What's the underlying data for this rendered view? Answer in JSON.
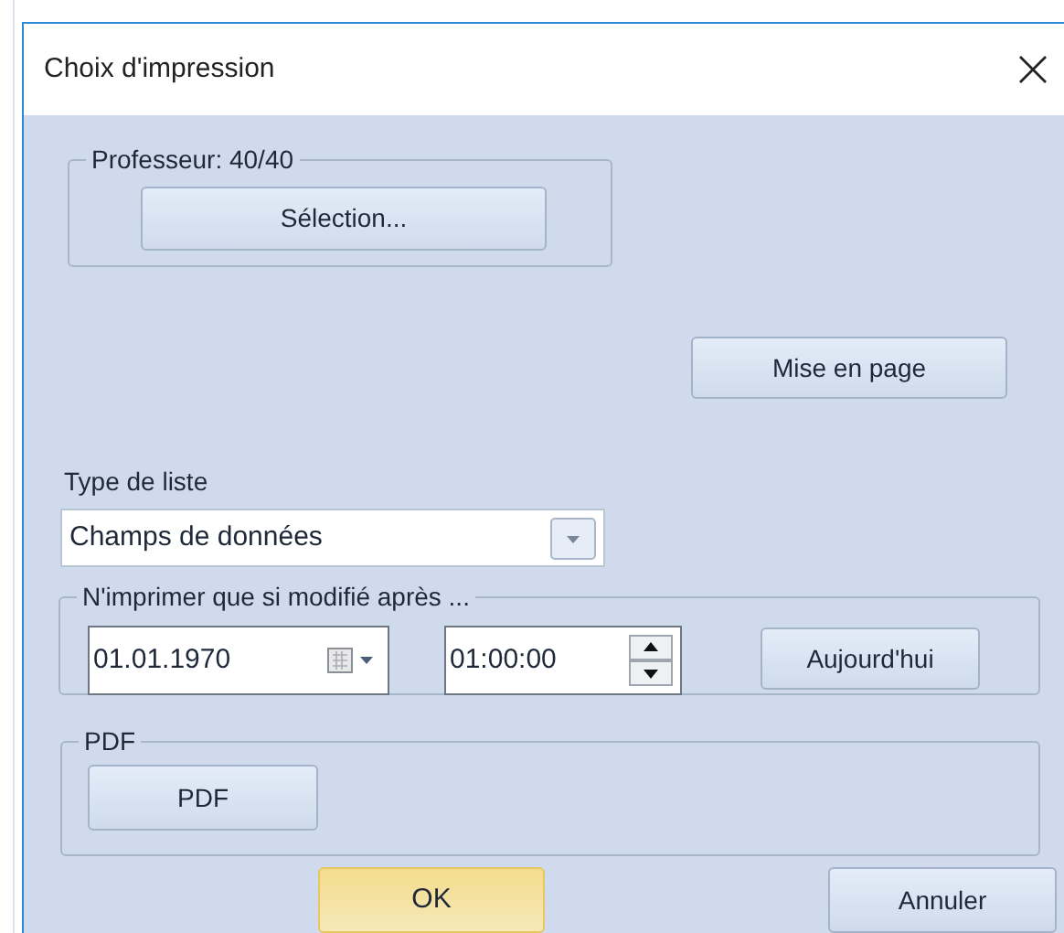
{
  "window": {
    "title": "Choix d'impression"
  },
  "teacher_group": {
    "legend": "Professeur: 40/40",
    "button": "Sélection..."
  },
  "page_setup_button": "Mise en page",
  "list_type": {
    "label": "Type de liste",
    "value": "Champs de données"
  },
  "modified_after": {
    "legend": "N'imprimer que si modifié après ...",
    "date": "01.01.1970",
    "time": "01:00:00",
    "today_button": "Aujourd'hui"
  },
  "pdf_group": {
    "legend": "PDF",
    "button": "PDF"
  },
  "buttons": [
    {
      "label": "OK",
      "default": true
    },
    {
      "label": "Annuler",
      "default": false
    }
  ]
}
